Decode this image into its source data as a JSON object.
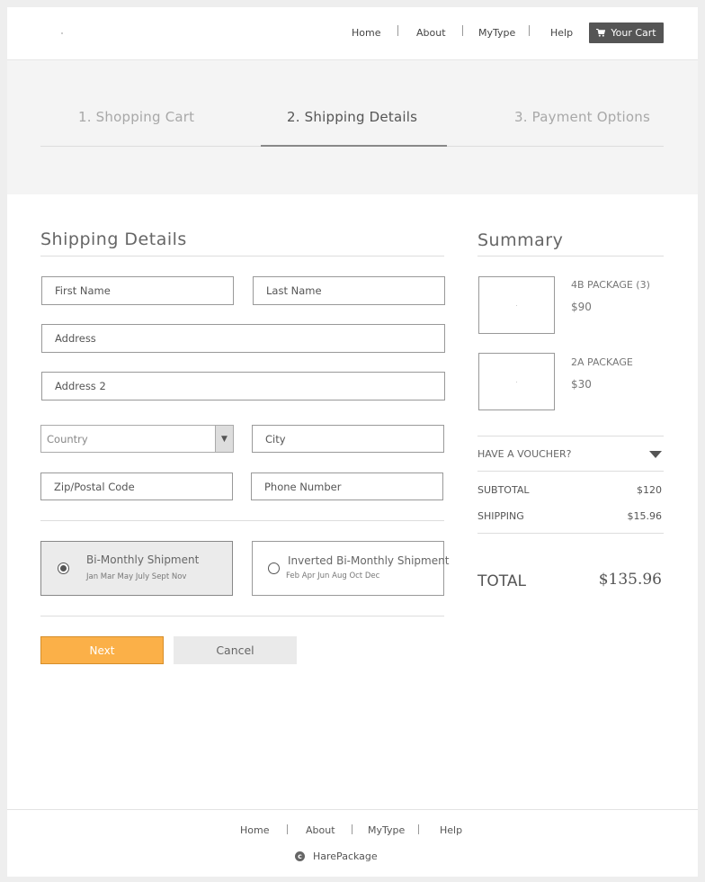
{
  "header": {
    "nav": [
      "Home",
      "About",
      "MyType",
      "Help"
    ],
    "cart_label": "Your Cart",
    "cart_icon": "cart-icon"
  },
  "steps": [
    {
      "label": "1. Shopping Cart",
      "active": false
    },
    {
      "label": "2. Shipping Details",
      "active": true
    },
    {
      "label": "3. Payment Options",
      "active": false
    }
  ],
  "shipping": {
    "title": "Shipping Details",
    "first_name": "First Name",
    "last_name": "Last Name",
    "address": "Address",
    "address2": "Address 2",
    "country": "Country",
    "city": "City",
    "zip": "Zip/Postal Code",
    "phone": "Phone Number",
    "options": [
      {
        "title": "Bi-Monthly Shipment",
        "months": "Jan Mar May July Sept Nov",
        "selected": true
      },
      {
        "title": "Inverted Bi-Monthly Shipment",
        "months": "Feb  Apr Jun Aug Oct Dec",
        "selected": false
      }
    ],
    "next_label": "Next",
    "cancel_label": "Cancel"
  },
  "summary": {
    "title": "Summary",
    "items": [
      {
        "name": "4B PACKAGE (3)",
        "price": "$90"
      },
      {
        "name": "2A PACKAGE",
        "price": "$30"
      }
    ],
    "voucher_label": "HAVE A VOUCHER?",
    "subtotal_label": "SUBTOTAL",
    "subtotal": "$120",
    "shipping_label": "SHIPPING",
    "shipping": "$15.96",
    "total_label": "TOTAL",
    "total": "$135.96"
  },
  "footer": {
    "nav": [
      "Home",
      "About",
      "MyType",
      "Help"
    ],
    "copyright_icon": "copyright-icon",
    "brand": "HarePackage"
  },
  "colors": {
    "accent": "#fbb048",
    "dark_button": "#555555",
    "band": "#f4f4f4"
  }
}
